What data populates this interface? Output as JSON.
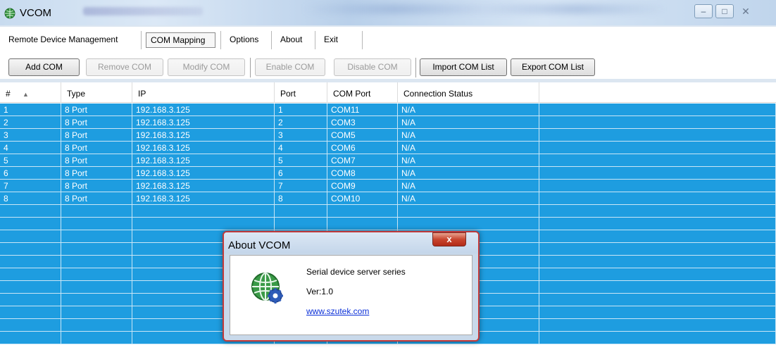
{
  "window": {
    "title": "VCOM"
  },
  "menu": {
    "items": [
      "Remote Device Management",
      "COM Mapping",
      "Options",
      "About",
      "Exit"
    ]
  },
  "toolbar": {
    "buttons": [
      "Add COM",
      "Remove COM",
      "Modify COM",
      "Enable COM",
      "Disable COM",
      "Import COM List",
      "Export COM List"
    ]
  },
  "table": {
    "columns": [
      "#",
      "Type",
      "IP",
      "Port",
      "COM Port",
      "Connection Status"
    ],
    "rows": [
      [
        "1",
        "8 Port",
        "192.168.3.125",
        "1",
        "COM11",
        "N/A"
      ],
      [
        "2",
        "8 Port",
        "192.168.3.125",
        "2",
        "COM3",
        "N/A"
      ],
      [
        "3",
        "8 Port",
        "192.168.3.125",
        "3",
        "COM5",
        "N/A"
      ],
      [
        "4",
        "8 Port",
        "192.168.3.125",
        "4",
        "COM6",
        "N/A"
      ],
      [
        "5",
        "8 Port",
        "192.168.3.125",
        "5",
        "COM7",
        "N/A"
      ],
      [
        "6",
        "8 Port",
        "192.168.3.125",
        "6",
        "COM8",
        "N/A"
      ],
      [
        "7",
        "8 Port",
        "192.168.3.125",
        "7",
        "COM9",
        "N/A"
      ],
      [
        "8",
        "8 Port",
        "192.168.3.125",
        "8",
        "COM10",
        "N/A"
      ]
    ]
  },
  "about_dialog": {
    "title": "About VCOM",
    "close_label": "x",
    "product": "Serial device server series",
    "version": "Ver:1.0",
    "link": "www.szutek.com"
  },
  "colors": {
    "selection": "#1e9de0",
    "dialog_border": "#c23a3a",
    "link": "#0b30d8"
  }
}
